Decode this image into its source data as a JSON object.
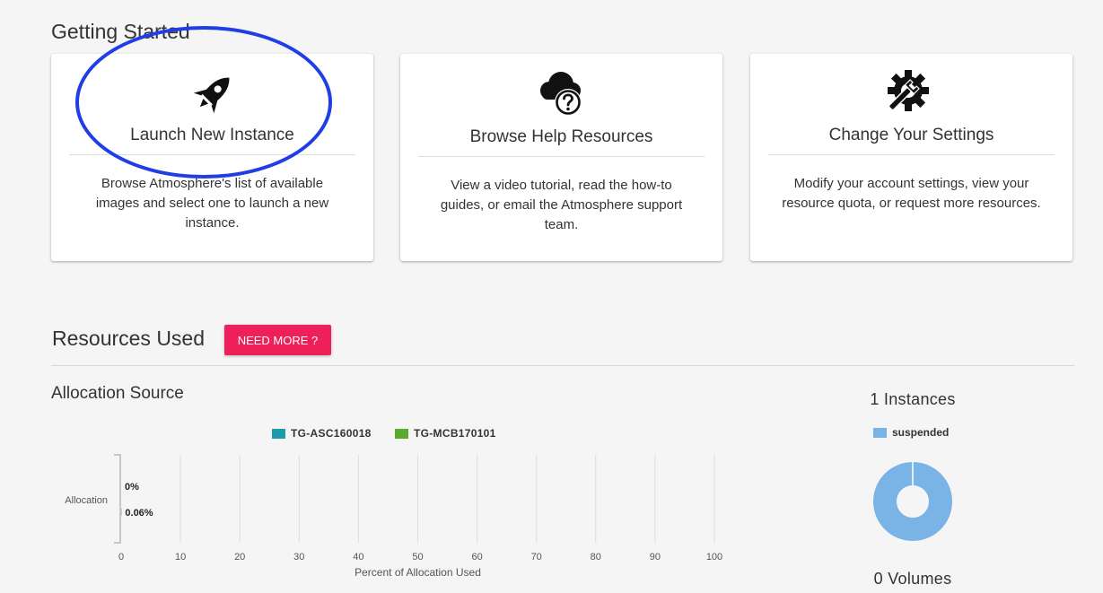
{
  "getting_started": {
    "title": "Getting Started",
    "cards": [
      {
        "icon": "rocket-icon",
        "title": "Launch New Instance",
        "description": "Browse Atmosphere's list of available images and select one to launch a new instance."
      },
      {
        "icon": "cloud-help-icon",
        "title": "Browse Help Resources",
        "description": "View a video tutorial, read the how-to guides, or email the Atmosphere support team."
      },
      {
        "icon": "gear-wrench-icon",
        "title": "Change Your Settings",
        "description": "Modify your account settings, view your resource quota, or request more resources."
      }
    ],
    "highlight_color": "#1f3ee6"
  },
  "resources": {
    "title": "Resources Used",
    "need_more_label": "NEED MORE ?",
    "need_more_color": "#ef1f5a",
    "allocation_title": "Allocation Source",
    "instances_title": "1 Instances",
    "volumes_title": "0 Volumes",
    "instances_legend": "suspended",
    "instances_color": "#7ab4e6"
  },
  "chart_data": [
    {
      "type": "bar",
      "orientation": "horizontal",
      "categories": [
        "Allocation"
      ],
      "series": [
        {
          "name": "TG-ASC160018",
          "values": [
            0
          ],
          "label": "0%",
          "color": "#1f9aaa"
        },
        {
          "name": "TG-MCB170101",
          "values": [
            0.06
          ],
          "label": "0.06%",
          "color": "#5aaa2f"
        }
      ],
      "xlabel": "Percent of Allocation Used",
      "ylabel": "",
      "xlim": [
        0,
        100
      ],
      "xticks": [
        0,
        10,
        20,
        30,
        40,
        50,
        60,
        70,
        80,
        90,
        100
      ],
      "grid": true,
      "legend": "top"
    },
    {
      "type": "pie",
      "donut": true,
      "categories": [
        "suspended"
      ],
      "values": [
        1
      ],
      "colors": [
        "#7ab4e6"
      ],
      "legend": "top"
    }
  ]
}
